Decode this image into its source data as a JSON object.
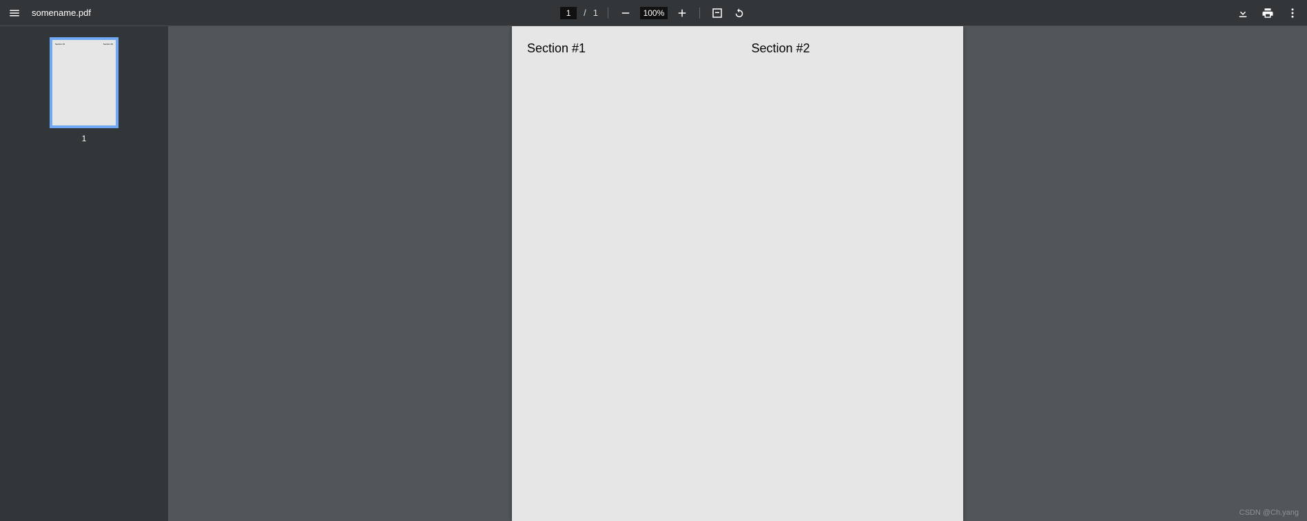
{
  "toolbar": {
    "file_name": "somename.pdf",
    "page_current": "1",
    "page_slash": "/",
    "page_total": "1",
    "zoom_value": "100%"
  },
  "sidebar": {
    "thumb": {
      "label": "1",
      "col1": "Section #1",
      "col2": "Section #2"
    }
  },
  "page": {
    "col1": "Section #1",
    "col2": "Section #2"
  },
  "watermark": "CSDN @Ch.yang"
}
